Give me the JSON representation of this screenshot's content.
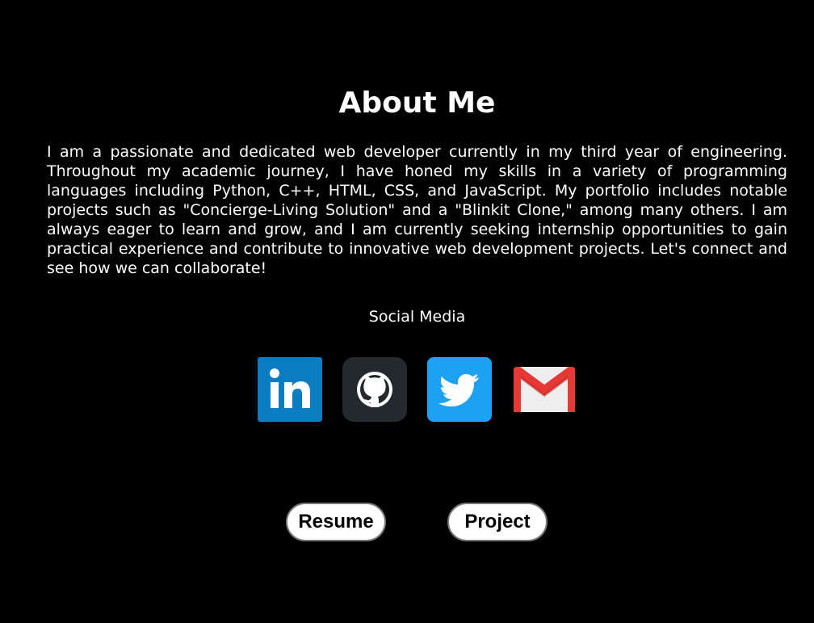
{
  "about": {
    "heading": "About Me",
    "bio": "I am a passionate and dedicated web developer currently in my third year of engineering. Throughout my academic journey, I have honed my skills in a variety of programming languages including Python, C++, HTML, CSS, and JavaScript. My portfolio includes notable projects such as \"Concierge-Living Solution\" and a \"Blinkit Clone,\" among many others. I am always eager to learn and grow, and I am currently seeking internship opportunities to gain practical experience and contribute to innovative web development projects. Let's connect and see how we can collaborate!"
  },
  "social": {
    "title": "Social Media",
    "links": [
      {
        "icon": "linkedin-icon",
        "color": "#0A7CC1"
      },
      {
        "icon": "github-icon",
        "color": "#24292E"
      },
      {
        "icon": "twitter-icon",
        "color": "#1DA1F2"
      },
      {
        "icon": "gmail-icon",
        "color": "#EA4335"
      }
    ]
  },
  "buttons": {
    "resume_label": "Resume",
    "project_label": "Project"
  }
}
